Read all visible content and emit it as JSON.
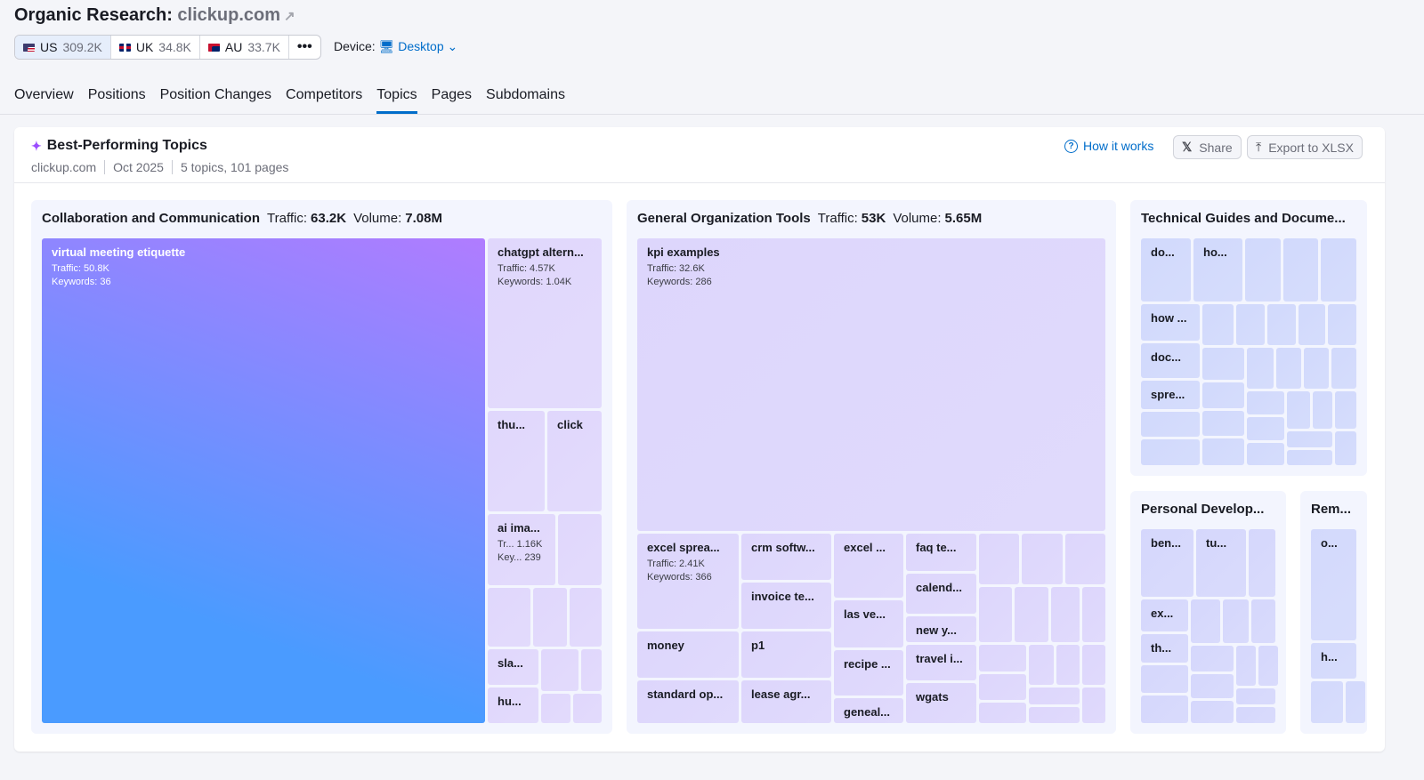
{
  "header": {
    "title": "Organic Research:",
    "domain": "clickup.com",
    "external_icon": "external-link-icon"
  },
  "databases": [
    {
      "flag": "US",
      "label": "US",
      "count": "309.2K",
      "selected": true
    },
    {
      "flag": "UK",
      "label": "UK",
      "count": "34.8K"
    },
    {
      "flag": "AU",
      "label": "AU",
      "count": "33.7K"
    }
  ],
  "more_label": "•••",
  "device": {
    "label": "Device:",
    "value": "Desktop",
    "icon": "monitor-icon"
  },
  "tabs": [
    {
      "label": "Overview"
    },
    {
      "label": "Positions"
    },
    {
      "label": "Position Changes"
    },
    {
      "label": "Competitors"
    },
    {
      "label": "Topics",
      "active": true
    },
    {
      "label": "Pages"
    },
    {
      "label": "Subdomains"
    }
  ],
  "card": {
    "title": "Best-Performing Topics",
    "domain": "clickup.com",
    "date": "Oct 2025",
    "summary": "5 topics, 101 pages",
    "how_it_works": "How it works",
    "share": "Share",
    "export": "Export to XLSX"
  },
  "colors": {
    "accent": "#006dca",
    "big_tile_from": "#4a9bff",
    "big_tile_to": "#b07cff"
  },
  "panels": [
    {
      "name": "Collaboration and Communication",
      "traffic_label": "Traffic:",
      "traffic": "63.2K",
      "volume_label": "Volume:",
      "volume": "7.08M",
      "tiles": [
        {
          "name": "virtual meeting etiquette",
          "traffic": "Traffic: 50.8K",
          "keywords": "Keywords: 36"
        },
        {
          "name": "chatgpt altern...",
          "traffic": "Traffic: 4.57K",
          "keywords": "Keywords: 1.04K"
        },
        {
          "name": "thu..."
        },
        {
          "name": "click"
        },
        {
          "name": "ai ima...",
          "traffic": "Tr...  1.16K",
          "keywords": "Key...  239"
        },
        {
          "name": "sla..."
        },
        {
          "name": "hu..."
        }
      ]
    },
    {
      "name": "General Organization Tools",
      "traffic_label": "Traffic:",
      "traffic": "53K",
      "volume_label": "Volume:",
      "volume": "5.65M",
      "tiles": [
        {
          "name": "kpi examples",
          "traffic": "Traffic: 32.6K",
          "keywords": "Keywords: 286"
        },
        {
          "name": "excel sprea...",
          "traffic": "Traffic: 2.41K",
          "keywords": "Keywords: 366"
        },
        {
          "name": "money"
        },
        {
          "name": "standard op..."
        },
        {
          "name": "crm softw..."
        },
        {
          "name": "invoice te..."
        },
        {
          "name": "p1"
        },
        {
          "name": "lease agr..."
        },
        {
          "name": "excel ..."
        },
        {
          "name": "las ve..."
        },
        {
          "name": "recipe ..."
        },
        {
          "name": "geneal..."
        },
        {
          "name": "faq te..."
        },
        {
          "name": "calend..."
        },
        {
          "name": "new y..."
        },
        {
          "name": "travel i..."
        },
        {
          "name": "wgats"
        }
      ]
    },
    {
      "name": "Technical Guides and Docume...",
      "tiles": [
        {
          "name": "do..."
        },
        {
          "name": "ho..."
        },
        {
          "name": "how ..."
        },
        {
          "name": "doc..."
        },
        {
          "name": "spre..."
        }
      ]
    },
    {
      "name": "Personal Develop...",
      "tiles": [
        {
          "name": "ben..."
        },
        {
          "name": "tu..."
        },
        {
          "name": "ex..."
        },
        {
          "name": "th..."
        }
      ]
    },
    {
      "name": "Rem...",
      "tiles": [
        {
          "name": "o..."
        },
        {
          "name": "h..."
        }
      ]
    }
  ]
}
